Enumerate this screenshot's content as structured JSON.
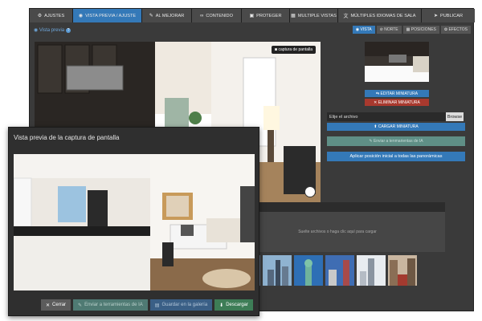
{
  "nav": {
    "items": [
      {
        "label": "AJUSTES",
        "icon": "gears-icon",
        "glyph": "⚙"
      },
      {
        "label": "VISTA PREVIA / AJUSTE",
        "icon": "eye-icon",
        "glyph": "◉"
      },
      {
        "label": "AL MEJORAR",
        "icon": "magic-wand-icon",
        "glyph": "✎"
      },
      {
        "label": "CONTENIDO",
        "icon": "link-icon",
        "glyph": "∞"
      },
      {
        "label": "PROTEGER",
        "icon": "lock-icon",
        "glyph": "▣"
      },
      {
        "label": "MULTIPLE VISTAS",
        "icon": "grid-icon",
        "glyph": "▦"
      },
      {
        "label": "MÚLTIPLES IDIOMAS DE SALA",
        "icon": "translate-icon",
        "glyph": "文"
      },
      {
        "label": "PUBLICAR",
        "icon": "paper-plane-icon",
        "glyph": "➤"
      }
    ]
  },
  "preview_label": "Vista previa",
  "view_tabs": [
    {
      "label": "VISTA",
      "icon": "eye-icon"
    },
    {
      "label": "NORTE",
      "icon": "compass-icon"
    },
    {
      "label": "POSICIONES",
      "icon": "grid-icon"
    },
    {
      "label": "EFECTOS",
      "icon": "palette-icon"
    }
  ],
  "pano": {
    "capture_label": "captura de pantalla"
  },
  "side": {
    "edit_thumb": "EDITAR MINIATURA",
    "delete_thumb": "ELIMINAR MINIATURA",
    "file_placeholder": "Elije el archivo",
    "browse": "Browse",
    "upload_thumb": "CARGAR MINIATURA",
    "send_ai": "Enviar a tenmarientas de IA",
    "apply_position": "Aplicar posición inicial a todas las panorámicas"
  },
  "dropzone_text": "Suelte archivos o haga clic aquí para cargar",
  "modal": {
    "title": "Vista previa de la captura de pantalla",
    "close": "Cerrar",
    "send_ai": "Enviar a terramientas de IA",
    "save_gallery": "Guardar en la galería",
    "download": "Descargar"
  },
  "colors": {
    "accent": "#3479b8",
    "danger": "#a8392e",
    "success": "#3d7d56"
  }
}
